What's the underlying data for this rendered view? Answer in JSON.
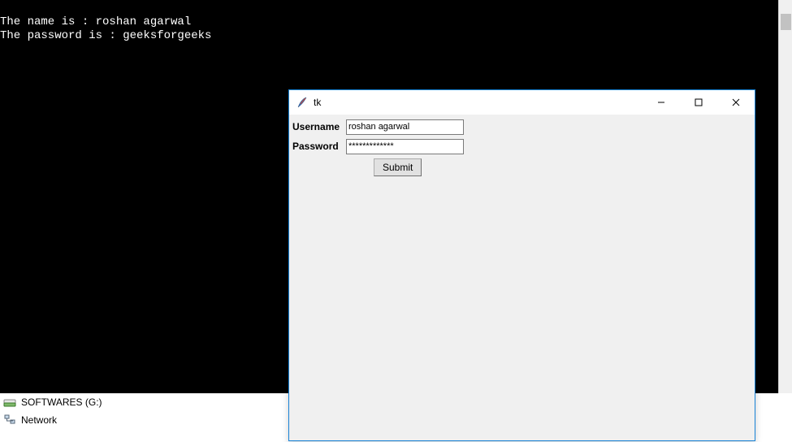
{
  "terminal": {
    "line1": "The name is : roshan agarwal",
    "line2": "The password is : geeksforgeeks"
  },
  "explorer": {
    "item1": "SOFTWARES (G:)",
    "item2": "Network"
  },
  "tk": {
    "title": "tk",
    "username_label": "Username",
    "username_value": "roshan agarwal",
    "password_label": "Password",
    "password_value": "*************",
    "submit_label": "Submit"
  }
}
